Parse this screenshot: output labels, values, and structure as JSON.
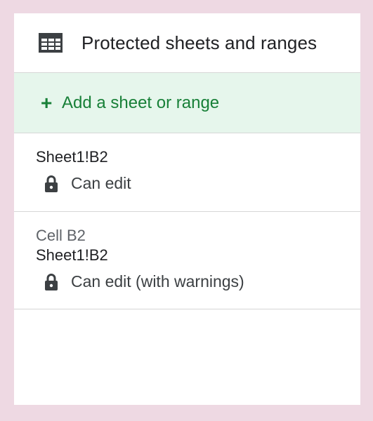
{
  "panel": {
    "title": "Protected sheets and ranges",
    "title_icon": "table-grid-icon"
  },
  "add": {
    "plus": "+",
    "label": "Add a sheet or range",
    "color": "#188038",
    "background": "#e6f6ec"
  },
  "protected_ranges": [
    {
      "description": "",
      "range": "Sheet1!B2",
      "permission_icon": "lock-icon",
      "permission": "Can edit"
    },
    {
      "description": "Cell B2",
      "range": "Sheet1!B2",
      "permission_icon": "lock-icon",
      "permission": "Can edit (with warnings)"
    }
  ]
}
